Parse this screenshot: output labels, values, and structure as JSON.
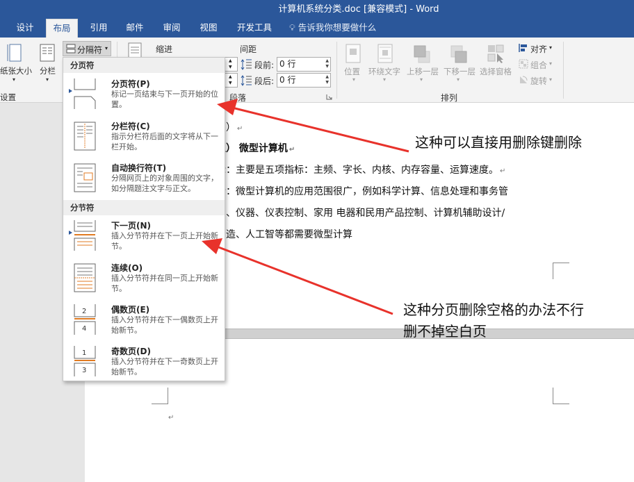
{
  "window": {
    "title": "计算机系统分类.doc [兼容模式] - Word"
  },
  "tabs": [
    {
      "label": "设计"
    },
    {
      "label": "布局"
    },
    {
      "label": "引用"
    },
    {
      "label": "邮件"
    },
    {
      "label": "审阅"
    },
    {
      "label": "视图"
    },
    {
      "label": "开发工具"
    }
  ],
  "tellme": "告诉我你想要做什么",
  "ribbon": {
    "page_setup": {
      "size_label": "纸张大小",
      "columns_label": "分栏",
      "group_label": "设置",
      "breaks_label": "分隔符"
    },
    "paragraph": {
      "indent_label": "缩进",
      "spacing_label": "间距",
      "before_label": "段前:",
      "before_value": "0 行",
      "after_label": "段后:",
      "after_value": "0 行",
      "group_label": "段落"
    },
    "arrange": {
      "position": "位置",
      "wrap_text": "环绕文字",
      "bring_forward": "上移一层",
      "send_backward": "下移一层",
      "selection_pane": "选择窗格",
      "align": "对齐",
      "group": "组合",
      "rotate": "旋转",
      "group_label": "排列"
    }
  },
  "breaks_menu": {
    "page_breaks_header": "分页符",
    "section_breaks_header": "分节符",
    "items": [
      {
        "title": "分页符(P)",
        "desc": "标记一页结束与下一页开始的位置。"
      },
      {
        "title": "分栏符(C)",
        "desc": "指示分栏符后面的文字将从下一栏开始。"
      },
      {
        "title": "自动换行符(T)",
        "desc": "分隔网页上的对象周围的文字，如分隔题注文字与正文。"
      },
      {
        "title": "下一页(N)",
        "desc": "插入分节符并在下一页上开始新节。"
      },
      {
        "title": "连续(O)",
        "desc": "插入分节符并在同一页上开始新节。"
      },
      {
        "title": "偶数页(E)",
        "desc": "插入分节符并在下一偶数页上开始新节。"
      },
      {
        "title": "奇数页(D)",
        "desc": "插入分节符并在下一奇数页上开始新节。"
      }
    ]
  },
  "document": {
    "lines": [
      {
        "text": "日）"
      },
      {
        "text": "五）  微型计算机"
      },
      {
        "text": "标：主要是五项指标：主频、字长、内核、内存容量、运算速度。"
      },
      {
        "text": "合：微型计算机的应用范围很广，例如科学计算、信息处理和事务管"
      },
      {
        "text": "制、仪器、仪表控制、家用 电器和民用产品控制、计算机辅助设计/"
      },
      {
        "text": "制造、人工智等都需要微型计算"
      }
    ]
  },
  "annotations": {
    "note1": "这种可以直接用删除键删除",
    "note2_line1": "这种分页删除空格的办法不行",
    "note2_line2": "删不掉空白页"
  },
  "colors": {
    "accent": "#2b579a",
    "arrow": "#e8322b"
  }
}
